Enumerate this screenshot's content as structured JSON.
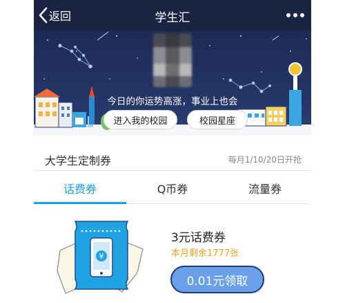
{
  "nav": {
    "back_label": "返回",
    "title": "学生汇",
    "more_icon": "more-dots-icon"
  },
  "banner": {
    "fortune_text": "今日的你运势高涨，事业上也会",
    "campus_button": "进入我的校园",
    "constellation_button": "校园星座"
  },
  "section": {
    "title": "大学生定制券",
    "schedule": "每月1/10/20日开抢"
  },
  "tabs": [
    {
      "label": "话费券",
      "active": true
    },
    {
      "label": "Q币券",
      "active": false
    },
    {
      "label": "流量券",
      "active": false
    }
  ],
  "coupon": {
    "title": "3元话费券",
    "remaining": "本月剩余1777张",
    "claim_button": "0.01元领取",
    "icon": "phone-yuan-ticket-icon",
    "currency_symbol": "¥"
  },
  "colors": {
    "nav_bg": "#1a2342",
    "accent": "#1aa0e3",
    "remaining_text": "#f0a223",
    "claim_button_bg": "#6aa0e8"
  }
}
